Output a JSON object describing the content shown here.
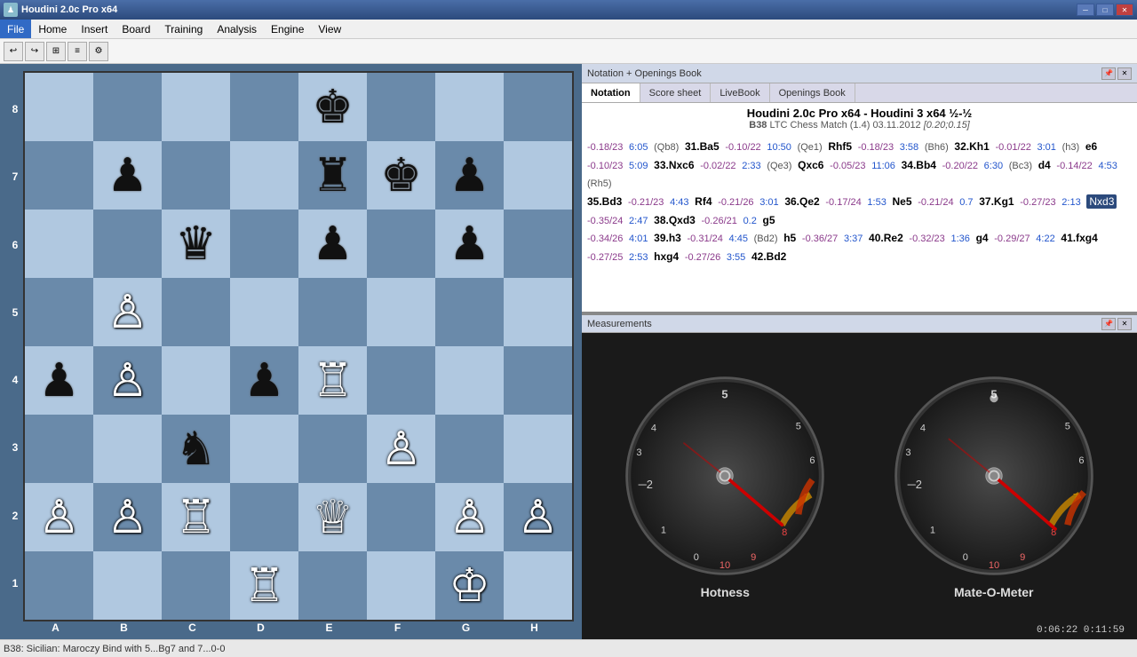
{
  "titlebar": {
    "title": "Houdini 2.0c Pro x64",
    "controls": [
      "minimize",
      "maximize",
      "close"
    ]
  },
  "menubar": {
    "items": [
      "File",
      "Home",
      "Insert",
      "Board",
      "Training",
      "Analysis",
      "Engine",
      "View"
    ],
    "active": "File"
  },
  "board": {
    "ranks": [
      "8",
      "7",
      "6",
      "5",
      "4",
      "3",
      "2",
      "1"
    ],
    "files": [
      "A",
      "B",
      "C",
      "D",
      "E",
      "F",
      "G",
      "H"
    ],
    "squares": [
      {
        "rank": 8,
        "file": 1,
        "piece": null
      },
      {
        "rank": 8,
        "file": 2,
        "piece": null
      },
      {
        "rank": 8,
        "file": 3,
        "piece": null
      },
      {
        "rank": 8,
        "file": 4,
        "piece": null
      },
      {
        "rank": 8,
        "file": 5,
        "piece": "bK"
      },
      {
        "rank": 8,
        "file": 6,
        "piece": null
      },
      {
        "rank": 8,
        "file": 7,
        "piece": null
      },
      {
        "rank": 8,
        "file": 8,
        "piece": null
      },
      {
        "rank": 7,
        "file": 1,
        "piece": null
      },
      {
        "rank": 7,
        "file": 2,
        "piece": "bP"
      },
      {
        "rank": 7,
        "file": 3,
        "piece": null
      },
      {
        "rank": 7,
        "file": 4,
        "piece": null
      },
      {
        "rank": 7,
        "file": 5,
        "piece": "bR"
      },
      {
        "rank": 7,
        "file": 6,
        "piece": "bK2"
      },
      {
        "rank": 7,
        "file": 7,
        "piece": "bP2"
      },
      {
        "rank": 7,
        "file": 8,
        "piece": null
      },
      {
        "rank": 6,
        "file": 1,
        "piece": null
      },
      {
        "rank": 6,
        "file": 2,
        "piece": null
      },
      {
        "rank": 6,
        "file": 3,
        "piece": "bQ"
      },
      {
        "rank": 6,
        "file": 4,
        "piece": null
      },
      {
        "rank": 6,
        "file": 5,
        "piece": "bP3"
      },
      {
        "rank": 6,
        "file": 6,
        "piece": null
      },
      {
        "rank": 6,
        "file": 7,
        "piece": "bP4"
      },
      {
        "rank": 6,
        "file": 8,
        "piece": null
      },
      {
        "rank": 5,
        "file": 1,
        "piece": null
      },
      {
        "rank": 5,
        "file": 2,
        "piece": "wP"
      },
      {
        "rank": 5,
        "file": 3,
        "piece": null
      },
      {
        "rank": 5,
        "file": 4,
        "piece": null
      },
      {
        "rank": 5,
        "file": 5,
        "piece": null
      },
      {
        "rank": 5,
        "file": 6,
        "piece": null
      },
      {
        "rank": 5,
        "file": 7,
        "piece": null
      },
      {
        "rank": 5,
        "file": 8,
        "piece": null
      },
      {
        "rank": 4,
        "file": 1,
        "piece": "bP5"
      },
      {
        "rank": 4,
        "file": 2,
        "piece": "wP2"
      },
      {
        "rank": 4,
        "file": 3,
        "piece": null
      },
      {
        "rank": 4,
        "file": 4,
        "piece": "bP6"
      },
      {
        "rank": 4,
        "file": 5,
        "piece": "wR"
      },
      {
        "rank": 4,
        "file": 6,
        "piece": null
      },
      {
        "rank": 4,
        "file": 7,
        "piece": null
      },
      {
        "rank": 4,
        "file": 8,
        "piece": null
      },
      {
        "rank": 3,
        "file": 1,
        "piece": null
      },
      {
        "rank": 3,
        "file": 2,
        "piece": null
      },
      {
        "rank": 3,
        "file": 3,
        "piece": "bN"
      },
      {
        "rank": 3,
        "file": 4,
        "piece": null
      },
      {
        "rank": 3,
        "file": 5,
        "piece": null
      },
      {
        "rank": 3,
        "file": 6,
        "piece": "wP3"
      },
      {
        "rank": 3,
        "file": 7,
        "piece": null
      },
      {
        "rank": 3,
        "file": 8,
        "piece": null
      },
      {
        "rank": 2,
        "file": 1,
        "piece": "wP4"
      },
      {
        "rank": 2,
        "file": 2,
        "piece": "wP5"
      },
      {
        "rank": 2,
        "file": 3,
        "piece": "wR2"
      },
      {
        "rank": 2,
        "file": 4,
        "piece": null
      },
      {
        "rank": 2,
        "file": 5,
        "piece": "wQ"
      },
      {
        "rank": 2,
        "file": 6,
        "piece": null
      },
      {
        "rank": 2,
        "file": 7,
        "piece": "wP6"
      },
      {
        "rank": 2,
        "file": 8,
        "piece": "wP7"
      },
      {
        "rank": 1,
        "file": 1,
        "piece": null
      },
      {
        "rank": 1,
        "file": 2,
        "piece": null
      },
      {
        "rank": 1,
        "file": 3,
        "piece": null
      },
      {
        "rank": 1,
        "file": 4,
        "piece": "wR3"
      },
      {
        "rank": 1,
        "file": 5,
        "piece": null
      },
      {
        "rank": 1,
        "file": 6,
        "piece": null
      },
      {
        "rank": 1,
        "file": 7,
        "piece": "wK"
      },
      {
        "rank": 1,
        "file": 8,
        "piece": null
      }
    ]
  },
  "status_bar": {
    "text": "B38: Sicilian: Maroczy Bind with 5...Bg7 and 7...0-0"
  },
  "notation_panel": {
    "header_title": "Notation + Openings Book",
    "tabs": [
      "Notation",
      "Score sheet",
      "LiveBook",
      "Openings Book"
    ],
    "active_tab": "Notation",
    "game_title": "Houdini 2.0c Pro x64 - Houdini 3 x64  ½-½",
    "game_subtitle_eco": "B38",
    "game_subtitle_event": "LTC Chess Match (1.4) 03.11.2012",
    "game_subtitle_times": "[0.20;0.15]",
    "moves_text": "-0.18/23  6:05 (Qb8) 31.Ba5  -0.10/22  10:50 (Qe1) Rhf5  -0.18/23  3:58 (Bh6) 32.Kh1  -0.01/22  3:01 (h3) e6  -0.10/23  5:09 33.Nxc6  -0.02/22  2:33 (Qe3) Qxc6  -0.05/23  11:06 34.Bb4  -0.20/22  6:30 (Bc3) d4  -0.14/22  4:53 (Rh5) 35.Bd3  -0.21/23  4:43 Rf4  -0.21/26  3:01 36.Qe2  -0.17/24  1:53 Ne5  -0.21/24  0.7  37.Kg1  -0.27/23  2:13 Nxd3  -0.35/24  2:47 38.Qxd3  -0.26/21  0.2  g5  -0.34/26  4:01 39.h3  -0.31/24  4:45 (Bd2) h5  -0.36/27  3:37 40.Re2  -0.32/23  1:36  g4  -0.29/27  4:22 41.fxg4  -0.27/25  2:53 hxg4  -0.27/26  3:55 42.Bd2"
  },
  "measurements_panel": {
    "header_title": "Measurements",
    "gauges": [
      {
        "label": "Hotness",
        "needle_angle": 145,
        "yellow_start": 140,
        "yellow_end": 160,
        "red_start": 160,
        "red_end": 185
      },
      {
        "label": "Mate-O-Meter",
        "needle_angle": 155,
        "yellow_start": 140,
        "yellow_end": 160,
        "red_start": 160,
        "red_end": 185
      }
    ]
  },
  "time_display": "0:06:22  0:11:59"
}
